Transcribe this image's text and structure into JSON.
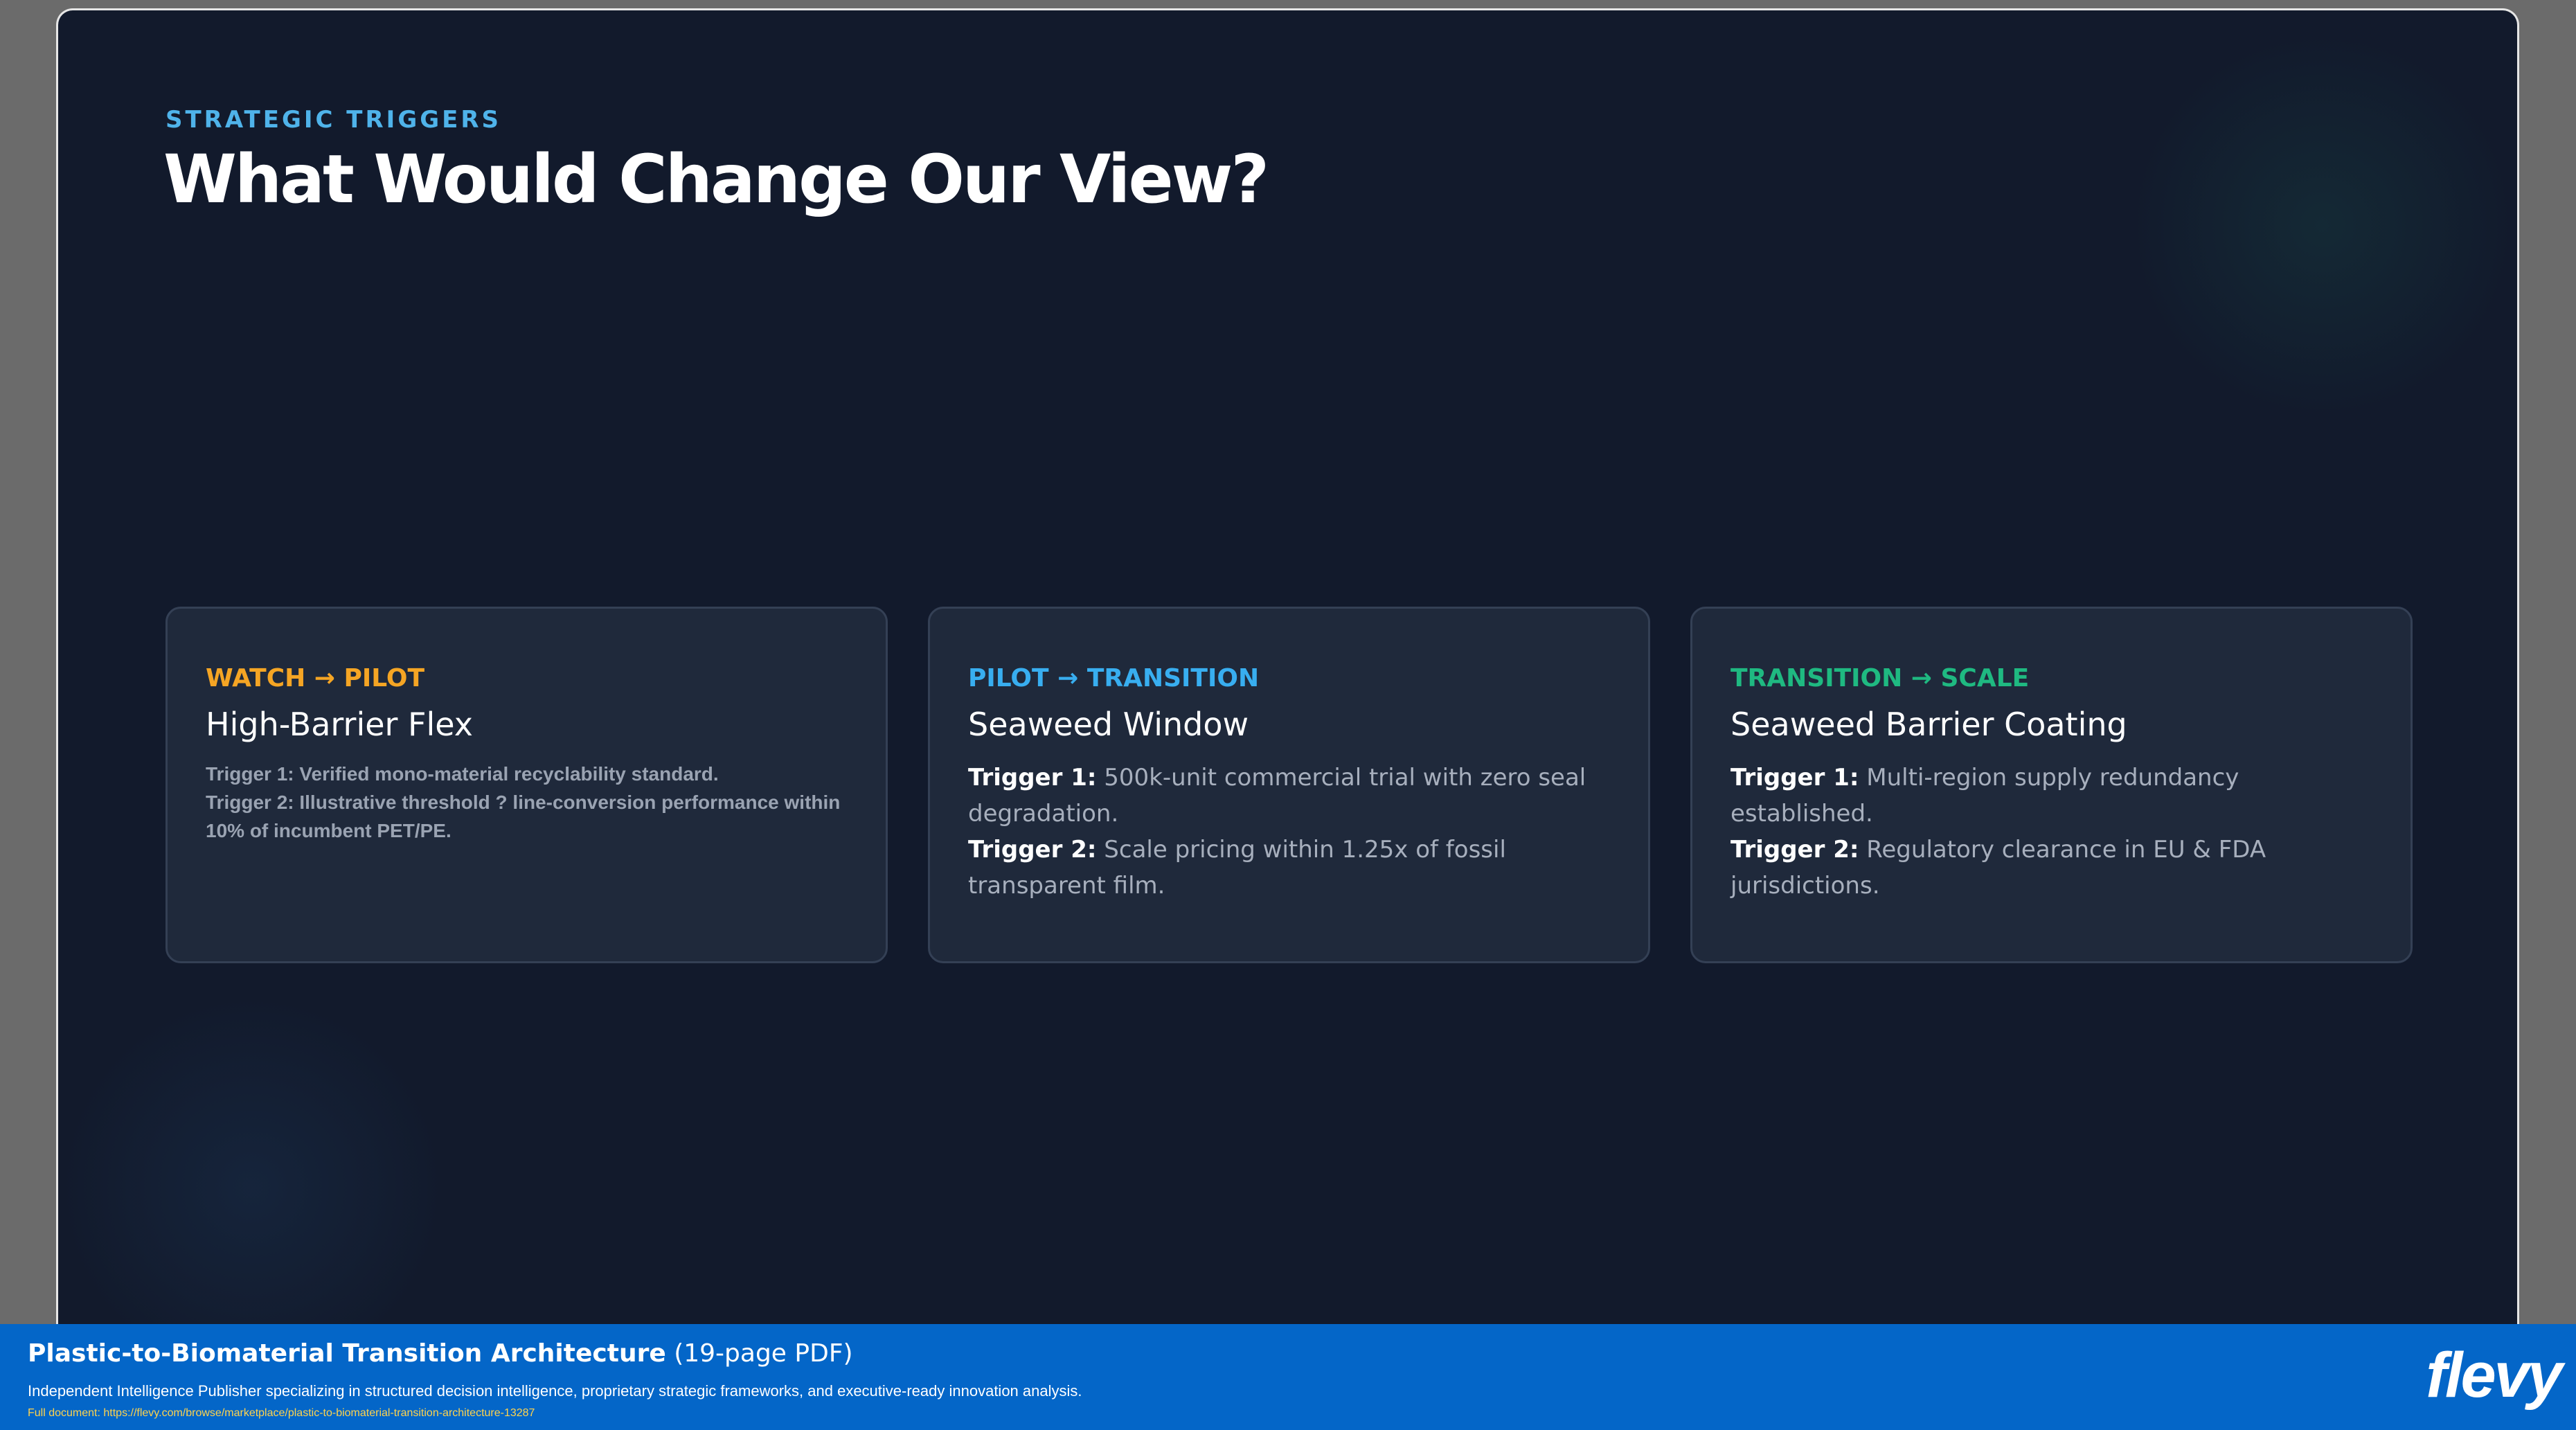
{
  "slide": {
    "eyebrow": "STRATEGIC TRIGGERS",
    "title": "What Would Change Our View?",
    "cards": [
      {
        "stage": "WATCH → PILOT",
        "stage_color": "#f5a524",
        "name": "High-Barrier Flex",
        "triggers": [
          "Trigger 1: Verified mono-material recyclability standard.",
          "Trigger 2: Illustrative threshold ? line-conversion performance within 10% of incumbent PET/PE."
        ]
      },
      {
        "stage": "PILOT → TRANSITION",
        "stage_color": "#38aef0",
        "name": "Seaweed Window",
        "triggers": [
          {
            "label": "Trigger 1:",
            "text": " 500k-unit commercial trial with zero seal degradation."
          },
          {
            "label": "Trigger 2:",
            "text": " Scale pricing within 1.25x of fossil transparent film."
          }
        ]
      },
      {
        "stage": "TRANSITION → SCALE",
        "stage_color": "#1fb981",
        "name": "Seaweed Barrier Coating",
        "triggers": [
          {
            "label": "Trigger 1:",
            "text": " Multi-region supply redundancy established."
          },
          {
            "label": "Trigger 2:",
            "text": " Regulatory clearance in EU & FDA jurisdictions."
          }
        ]
      }
    ]
  },
  "footer": {
    "title": "Plastic-to-Biomaterial Transition Architecture",
    "pages": " (19-page PDF)",
    "description": "Independent Intelligence Publisher specializing in structured decision intelligence, proprietary strategic frameworks, and executive-ready innovation analysis.",
    "link": "Full document: https://flevy.com/browse/marketplace/plastic-to-biomaterial-transition-architecture-13287",
    "logo": "flevy"
  }
}
